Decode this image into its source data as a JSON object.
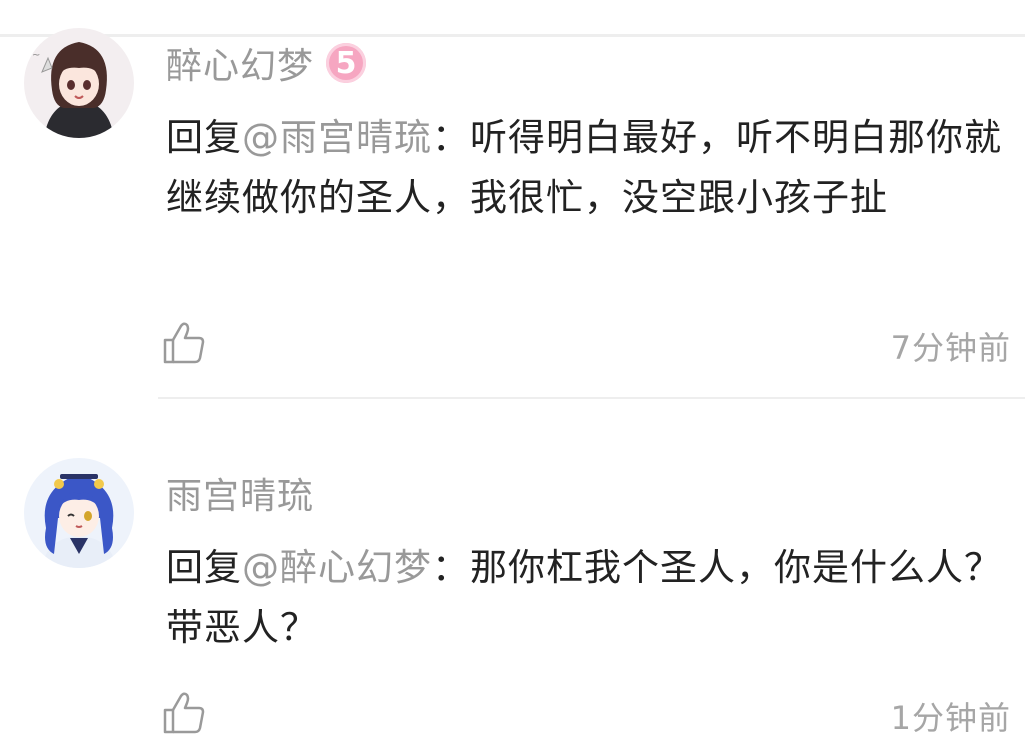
{
  "comments": [
    {
      "username": "醉心幻梦",
      "level": "5",
      "reply_prefix": "回复",
      "mention": "@雨宫晴琉",
      "separator": "：",
      "text": "听得明白最好，听不明白那你就继续做你的圣人，我很忙，没空跟小孩子扯",
      "timestamp": "7分钟前",
      "like_icon": "thumbs-up-icon"
    },
    {
      "username": "雨宫晴琉",
      "reply_prefix": "回复",
      "mention": "@醉心幻梦",
      "separator": "：",
      "text": "那你杠我个圣人，你是什么人？带恶人？",
      "timestamp": "1分钟前",
      "like_icon": "thumbs-up-icon"
    }
  ],
  "colors": {
    "username": "#999999",
    "body_text": "#222222",
    "mention": "#999999",
    "timestamp": "#a6a6a6",
    "level_badge": "#f6a6c1",
    "divider": "#eeeeee"
  }
}
